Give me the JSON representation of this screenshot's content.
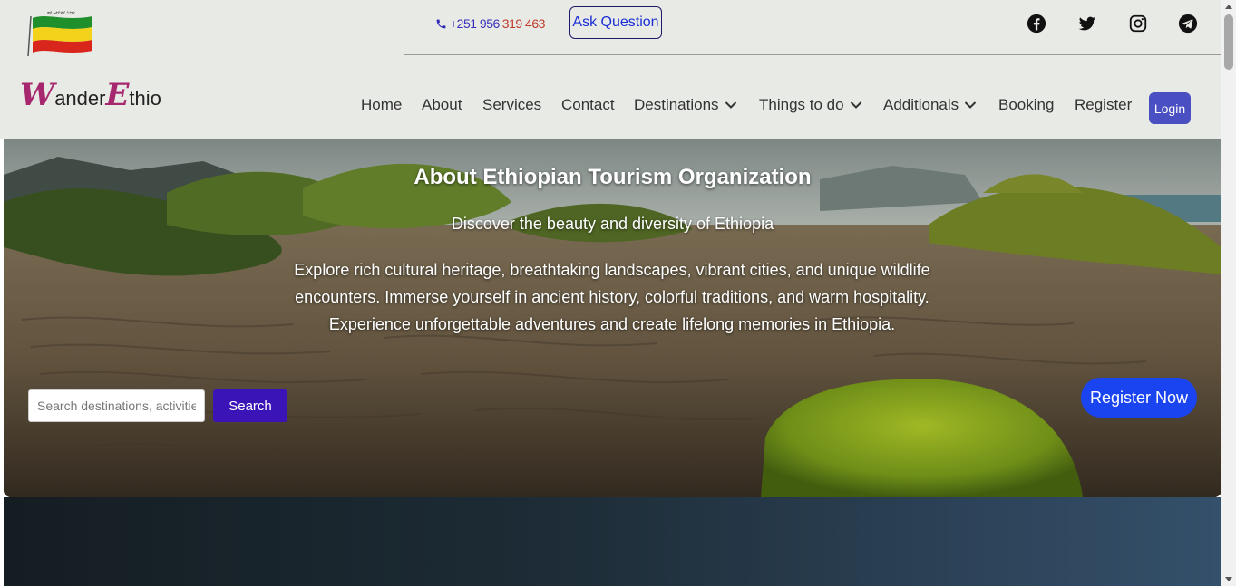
{
  "header": {
    "phone_number_a": "+251 956",
    "phone_number_b": "319 463",
    "ask_button_label": "Ask Question",
    "social": [
      "facebook-icon",
      "twitter-icon",
      "instagram-icon",
      "telegram-icon"
    ],
    "flag_caption": "ወደ ኢትዮጵያ እንኳን"
  },
  "logo": {
    "initial_1": "W",
    "part_1": "ander",
    "initial_2": "E",
    "part_2": "thio"
  },
  "nav": {
    "home": "Home",
    "about": "About",
    "services": "Services",
    "contact": "Contact",
    "destinations": "Destinations",
    "things_to_do": "Things to do",
    "additionals": "Additionals",
    "booking": "Booking",
    "register": "Register",
    "login": "Login"
  },
  "hero": {
    "title": "About Ethiopian Tourism Organization",
    "subtitle": "Discover the beauty and diversity of Ethiopia",
    "description": "Explore rich cultural heritage, breathtaking landscapes, vibrant cities, and unique wildlife encounters. Immerse yourself in ancient history, colorful traditions, and warm hospitality. Experience unforgettable adventures and create lifelong memories in Ethiopia.",
    "search_placeholder": "Search destinations, activities...",
    "search_button": "Search",
    "register_button": "Register Now"
  },
  "colors": {
    "header_bg": "#e8eae6",
    "brand_magenta": "#a6276e",
    "login_bg": "#4a4fc2",
    "search_btn_bg": "#3b14b8",
    "register_btn_bg": "#1a44f0"
  }
}
